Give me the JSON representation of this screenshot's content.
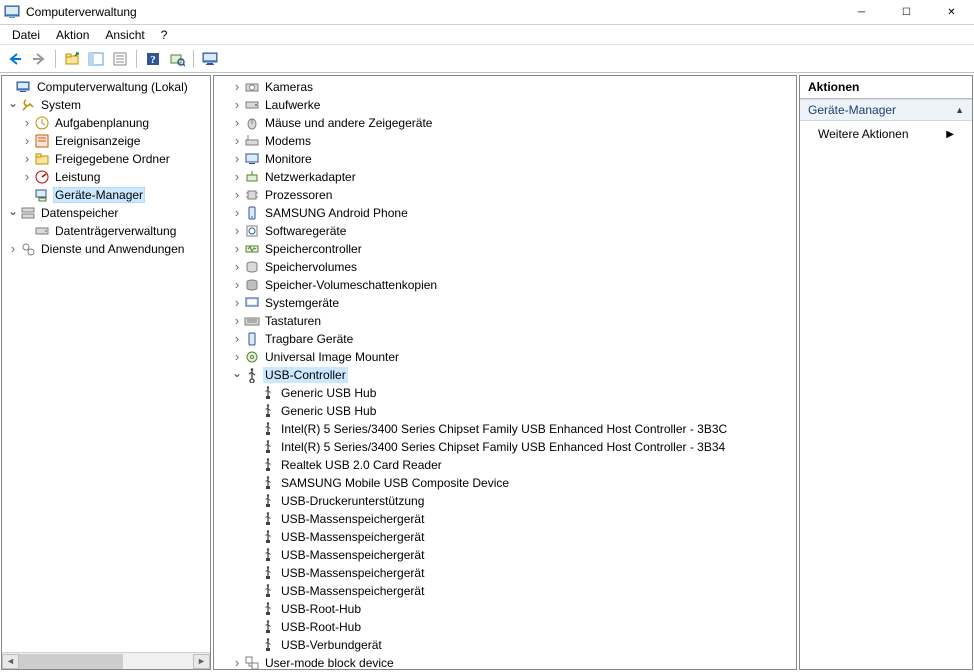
{
  "window": {
    "title": "Computerverwaltung"
  },
  "menu": {
    "file": "Datei",
    "action": "Aktion",
    "view": "Ansicht",
    "help": "?"
  },
  "left_tree": {
    "root": "Computerverwaltung (Lokal)",
    "system": "System",
    "system_children": {
      "scheduler": "Aufgabenplanung",
      "event": "Ereignisanzeige",
      "shared": "Freigegebene Ordner",
      "perf": "Leistung",
      "devmgr": "Geräte-Manager"
    },
    "storage": "Datenspeicher",
    "storage_children": {
      "diskmgmt": "Datenträgerverwaltung"
    },
    "services": "Dienste und Anwendungen"
  },
  "center_tree": {
    "categories": [
      "Kameras",
      "Laufwerke",
      "Mäuse und andere Zeigegeräte",
      "Modems",
      "Monitore",
      "Netzwerkadapter",
      "Prozessoren",
      "SAMSUNG Android Phone",
      "Softwaregeräte",
      "Speichercontroller",
      "Speichervolumes",
      "Speicher-Volumeschattenkopien",
      "Systemgeräte",
      "Tastaturen",
      "Tragbare Geräte",
      "Universal Image Mounter"
    ],
    "usb_controller": "USB-Controller",
    "usb_children": [
      "Generic USB Hub",
      "Generic USB Hub",
      "Intel(R) 5 Series/3400 Series Chipset Family USB Enhanced Host Controller - 3B3C",
      "Intel(R) 5 Series/3400 Series Chipset Family USB Enhanced Host Controller - 3B34",
      "Realtek USB 2.0 Card Reader",
      "SAMSUNG Mobile USB Composite Device",
      "USB-Druckerunterstützung",
      "USB-Massenspeichergerät",
      "USB-Massenspeichergerät",
      "USB-Massenspeichergerät",
      "USB-Massenspeichergerät",
      "USB-Massenspeichergerät",
      "USB-Root-Hub",
      "USB-Root-Hub",
      "USB-Verbundgerät"
    ],
    "usermode": "User-mode block device"
  },
  "actions": {
    "header": "Aktionen",
    "section": "Geräte-Manager",
    "more": "Weitere Aktionen"
  },
  "icons": {
    "categories": [
      "camera",
      "drive",
      "mouse",
      "modem",
      "monitor",
      "network",
      "cpu",
      "phone",
      "software",
      "storage-ctrl",
      "volume",
      "shadow",
      "system",
      "keyboard",
      "portable",
      "mounter"
    ]
  }
}
